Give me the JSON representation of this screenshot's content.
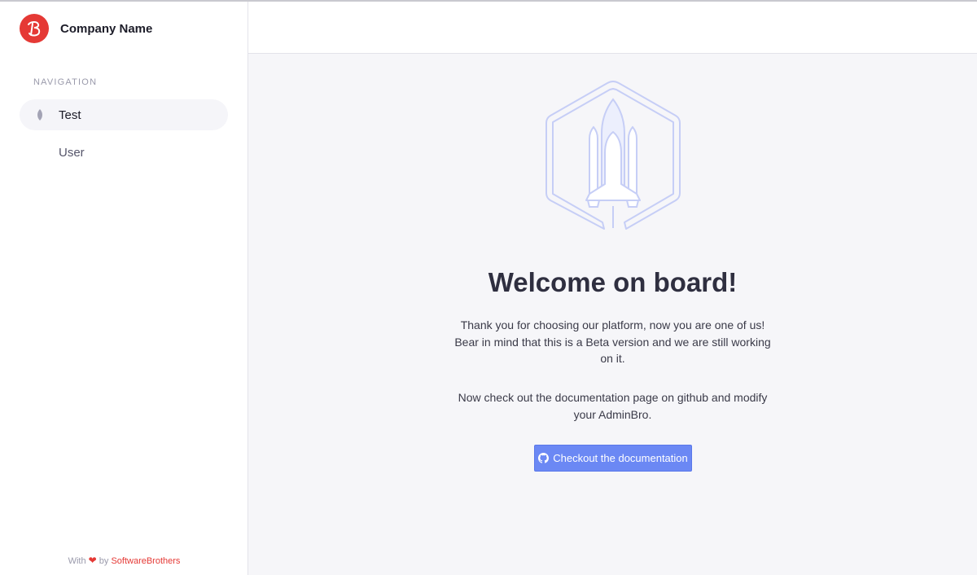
{
  "brand": {
    "name": "Company Name",
    "logo_icon": "brand-logo-icon",
    "logo_color": "#e53935"
  },
  "navigation": {
    "heading": "NAVIGATION",
    "items": [
      {
        "label": "Test",
        "icon": "leaf-icon",
        "active": true
      },
      {
        "label": "User",
        "active": false
      }
    ]
  },
  "footer": {
    "prefix": "With",
    "heart": "❤",
    "by": "by",
    "link": "SoftwareBrothers"
  },
  "welcome": {
    "illustration_icon": "rocket-icon",
    "title": "Welcome on board!",
    "paragraph1": "Thank you for choosing our platform, now you are one of us! Bear in mind that this is a Beta version and we are still working on it.",
    "paragraph2": "Now check out the documentation page on github and modify your AdminBro.",
    "button_label": "Checkout the documentation",
    "button_icon": "github-icon"
  },
  "colors": {
    "accent": "#6b88f4",
    "brand": "#e53935",
    "background": "#f6f6f9"
  }
}
